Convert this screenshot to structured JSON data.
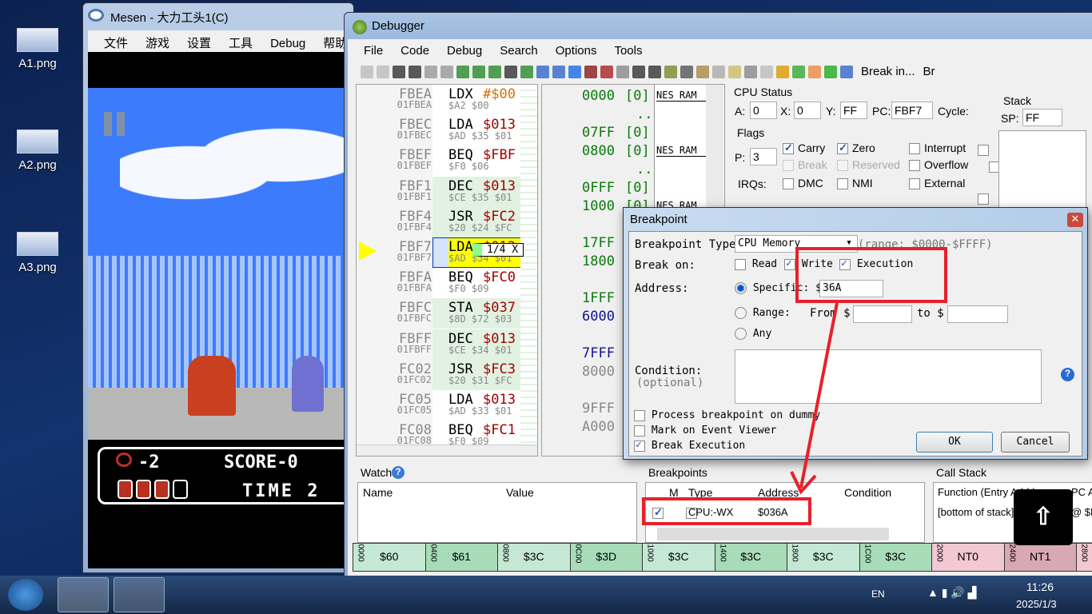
{
  "desktop": {
    "icons": [
      {
        "label": "A1.png"
      },
      {
        "label": "A2.png"
      },
      {
        "label": "A3.png"
      }
    ]
  },
  "mesen": {
    "title": "Mesen - 大力工头1(C)",
    "menu": [
      "文件",
      "游戏",
      "设置",
      "工具",
      "Debug",
      "帮助"
    ],
    "hud": {
      "lives": "-2",
      "score": "SCORE-0",
      "time": "TIME 2",
      "health_full": 3,
      "health_total": 4
    }
  },
  "debugger": {
    "title": "Debugger",
    "menu": [
      "File",
      "Code",
      "Debug",
      "Search",
      "Options",
      "Tools"
    ],
    "toolbar_break_in": "Break in...",
    "toolbar_extra": "Br",
    "code": [
      {
        "addr": "FBEA",
        "full": "01FBEA",
        "op": "LDX",
        "arg": "#$00",
        "bytes": "$A2 $00",
        "hl": "none"
      },
      {
        "addr": "FBEC",
        "full": "01FBEC",
        "op": "LDA",
        "arg": "$013",
        "bytes": "$AD $35 $01",
        "hl": "none"
      },
      {
        "addr": "FBEF",
        "full": "01FBEF",
        "op": "BEQ",
        "arg": "$FBF",
        "bytes": "$F0 $06",
        "hl": "none"
      },
      {
        "addr": "FBF1",
        "full": "01FBF1",
        "op": "DEC",
        "arg": "$013",
        "bytes": "$CE $35 $01",
        "hl": "green"
      },
      {
        "addr": "FBF4",
        "full": "01FBF4",
        "op": "JSR",
        "arg": "$FC2",
        "bytes": "$20 $24 $FC",
        "hl": "green"
      },
      {
        "addr": "FBF7",
        "full": "01FBF7",
        "op": "LDA",
        "arg": "$013",
        "bytes": "$AD $34 $01",
        "hl": "current"
      },
      {
        "addr": "FBFA",
        "full": "01FBFA",
        "op": "BEQ",
        "arg": "$FC0",
        "bytes": "$F0 $09",
        "hl": "none"
      },
      {
        "addr": "FBFC",
        "full": "01FBFC",
        "op": "STA",
        "arg": "$037",
        "bytes": "$8D $72 $03",
        "hl": "green"
      },
      {
        "addr": "FBFF",
        "full": "01FBFF",
        "op": "DEC",
        "arg": "$013",
        "bytes": "$CE $34 $01",
        "hl": "green"
      },
      {
        "addr": "FC02",
        "full": "01FC02",
        "op": "JSR",
        "arg": "$FC3",
        "bytes": "$20 $31 $FC",
        "hl": "green"
      },
      {
        "addr": "FC05",
        "full": "01FC05",
        "op": "LDA",
        "arg": "$013",
        "bytes": "$AD $33 $01",
        "hl": "none"
      },
      {
        "addr": "FC08",
        "full": "01FC08",
        "op": "BEQ",
        "arg": "$FC1",
        "bytes": "$F0 $09",
        "hl": "none"
      }
    ],
    "code_tooltip": "1/4 X",
    "memmap": [
      {
        "t": "0000",
        "b": "[0]",
        "c": "#0a7a0a",
        "row": 0,
        "label": "NES RAM"
      },
      {
        "t": "..",
        "c": "#0a7a0a",
        "row": 1
      },
      {
        "t": "07FF",
        "b": "[0]",
        "c": "#0a7a0a",
        "row": 2
      },
      {
        "t": "0800",
        "b": "[0]",
        "c": "#0a7a0a",
        "row": 3,
        "label": "NES RAM"
      },
      {
        "t": "..",
        "c": "#0a7a0a",
        "row": 4
      },
      {
        "t": "0FFF",
        "b": "[0]",
        "c": "#0a7a0a",
        "row": 5
      },
      {
        "t": "1000",
        "b": "[0]",
        "c": "#0a7a0a",
        "row": 6,
        "label": "NES RAM"
      },
      {
        "t": "17FF",
        "b": "[0]",
        "c": "#0a7a0a",
        "row": 8
      },
      {
        "t": "1800",
        "b": "[0]",
        "c": "#0a7a0a",
        "row": 9
      },
      {
        "t": "1FFF",
        "c": "#0a7a0a",
        "row": 11
      },
      {
        "t": "6000",
        "c": "#10109a",
        "row": 12
      },
      {
        "t": "7FFF",
        "c": "#10109a",
        "row": 14
      },
      {
        "t": "8000",
        "c": "#888888",
        "row": 15
      },
      {
        "t": "9FFF",
        "c": "#888888",
        "row": 17
      },
      {
        "t": "A000",
        "c": "#888888",
        "row": 18
      }
    ],
    "cpu": {
      "title": "CPU Status",
      "a": "0",
      "x": "0",
      "y": "FF",
      "pc": "FBF7",
      "cycle_label": "Cycle:",
      "flags_title": "Flags",
      "p": "3",
      "flags": [
        {
          "label": "Carry",
          "on": true
        },
        {
          "label": "Zero",
          "on": true
        },
        {
          "label": "Interrupt",
          "on": false
        },
        {
          "label": "Break",
          "on": false,
          "disabled": true
        },
        {
          "label": "Reserved",
          "on": false,
          "disabled": true
        },
        {
          "label": "Overflow",
          "on": false
        }
      ],
      "irqs_label": "IRQs:",
      "irqs": [
        "DMC",
        "NMI",
        "External"
      ],
      "stack_title": "Stack",
      "sp": "FF"
    },
    "watch": {
      "title": "Watch",
      "cols": [
        "Name",
        "Value"
      ]
    },
    "breakpoints": {
      "title": "Breakpoints",
      "cols": [
        "M",
        "Type",
        "Address",
        "Condition"
      ],
      "rows": [
        {
          "enabled": true,
          "mark": false,
          "type": "CPU:-WX",
          "address": "$036A",
          "condition": ""
        }
      ]
    },
    "callstack": {
      "title": "Call Stack",
      "cols": [
        "Function (Entry Addr)",
        "PC A"
      ],
      "rows": [
        {
          "fn": "[bottom of stack]",
          "pc": "@ $F"
        }
      ]
    },
    "membar": [
      {
        "a": "0000",
        "v": "$60",
        "c": "#c4e8d4"
      },
      {
        "a": "0400",
        "v": "$61",
        "c": "#a8dcb8"
      },
      {
        "a": "0800",
        "v": "$3C",
        "c": "#c4e8d4"
      },
      {
        "a": "0C00",
        "v": "$3D",
        "c": "#a8dcb8"
      },
      {
        "a": "1000",
        "v": "$3C",
        "c": "#c4e8d4"
      },
      {
        "a": "1400",
        "v": "$3C",
        "c": "#a8dcb8"
      },
      {
        "a": "1800",
        "v": "$3C",
        "c": "#c4e8d4"
      },
      {
        "a": "1C00",
        "v": "$3C",
        "c": "#a8dcb8"
      },
      {
        "a": "2000",
        "v": "NT0",
        "c": "#f2c8d4"
      },
      {
        "a": "2400",
        "v": "NT1",
        "c": "#d8a8b4"
      },
      {
        "a": "2800",
        "v": "",
        "c": "#f2c8d4"
      }
    ]
  },
  "dialog": {
    "title": "Breakpoint",
    "type_label": "Breakpoint Type:",
    "type_value": "CPU Memory",
    "range_hint": "(range: $0000-$FFFF)",
    "break_on_label": "Break on:",
    "read": {
      "label": "Read",
      "on": false
    },
    "write": {
      "label": "Write",
      "on": true
    },
    "exec": {
      "label": "Execution",
      "on": true
    },
    "address_label": "Address:",
    "specific_label": "Specific:",
    "dollar": "$",
    "specific_value": "36A",
    "range_label": "Range:",
    "from_label": "From $",
    "to_label": "to $",
    "any_label": "Any",
    "condition_label": "Condition:",
    "condition_hint": "(optional)",
    "opt_dummy": "Process breakpoint on dummy",
    "opt_event": "Mark on Event Viewer",
    "opt_break": "Break Execution",
    "ok": "OK",
    "cancel": "Cancel"
  },
  "taskbar": {
    "lang": "EN",
    "time": "11:26",
    "date": "2025/1/3"
  },
  "annotation_color": "#e8202a"
}
